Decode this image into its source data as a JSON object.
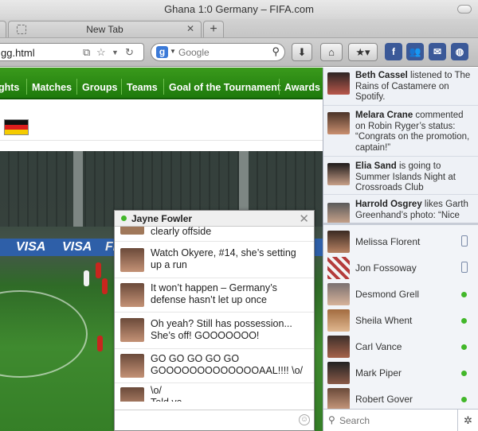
{
  "window": {
    "title": "Ghana 1:0 Germany – FIFA.com"
  },
  "tabs": [
    {
      "label": "New Tab"
    }
  ],
  "toolbar": {
    "url": "gg.html",
    "search_placeholder": "Google"
  },
  "nav": {
    "items": [
      "ghts",
      "Matches",
      "Groups",
      "Teams",
      "Goal of the Tournament",
      "Awards"
    ]
  },
  "photo": {
    "boards": [
      "VISA",
      "VISA",
      "FI"
    ]
  },
  "chat": {
    "name": "Jayne Fowler",
    "messages": [
      {
        "text": "clearly offside"
      },
      {
        "text": "Watch Okyere, #14, she’s setting up a run"
      },
      {
        "text": "It won’t happen – Germany’s defense hasn’t let up once"
      },
      {
        "text": "Oh yeah?  Still has possession... She’s off!  GOOOOOOO!"
      },
      {
        "text": "GO GO GO GO GO GOOOOOOOOOOOOOAAL!!!! \\o/"
      },
      {
        "text": "\\o/\nTold ya"
      }
    ]
  },
  "ticker": [
    {
      "name": "Beth Cassel",
      "text": " listened to The Rains of Castamere on Spotify."
    },
    {
      "name": "Melara Crane",
      "text": " commented on Robin Ryger’s status: “Congrats on the promotion, captain!”"
    },
    {
      "name": "Elia Sand",
      "text": " is going to Summer Islands Night at Crossroads Club"
    },
    {
      "name": "Harrold Osgrey",
      "text": " likes Garth Greenhand’s photo: “Nice"
    }
  ],
  "friends": [
    {
      "name": "Melissa Florent",
      "status": "mobile"
    },
    {
      "name": "Jon Fossoway",
      "status": "mobile"
    },
    {
      "name": "Desmond Grell",
      "status": "online"
    },
    {
      "name": "Sheila Whent",
      "status": "online"
    },
    {
      "name": "Carl Vance",
      "status": "online"
    },
    {
      "name": "Mark Piper",
      "status": "online"
    },
    {
      "name": "Robert Gover",
      "status": "online"
    }
  ],
  "sidebar": {
    "search_placeholder": "Search"
  },
  "colors": {
    "nav_green": "#2a8a15",
    "facebook_blue": "#3b5998",
    "online_green": "#42b72a"
  }
}
